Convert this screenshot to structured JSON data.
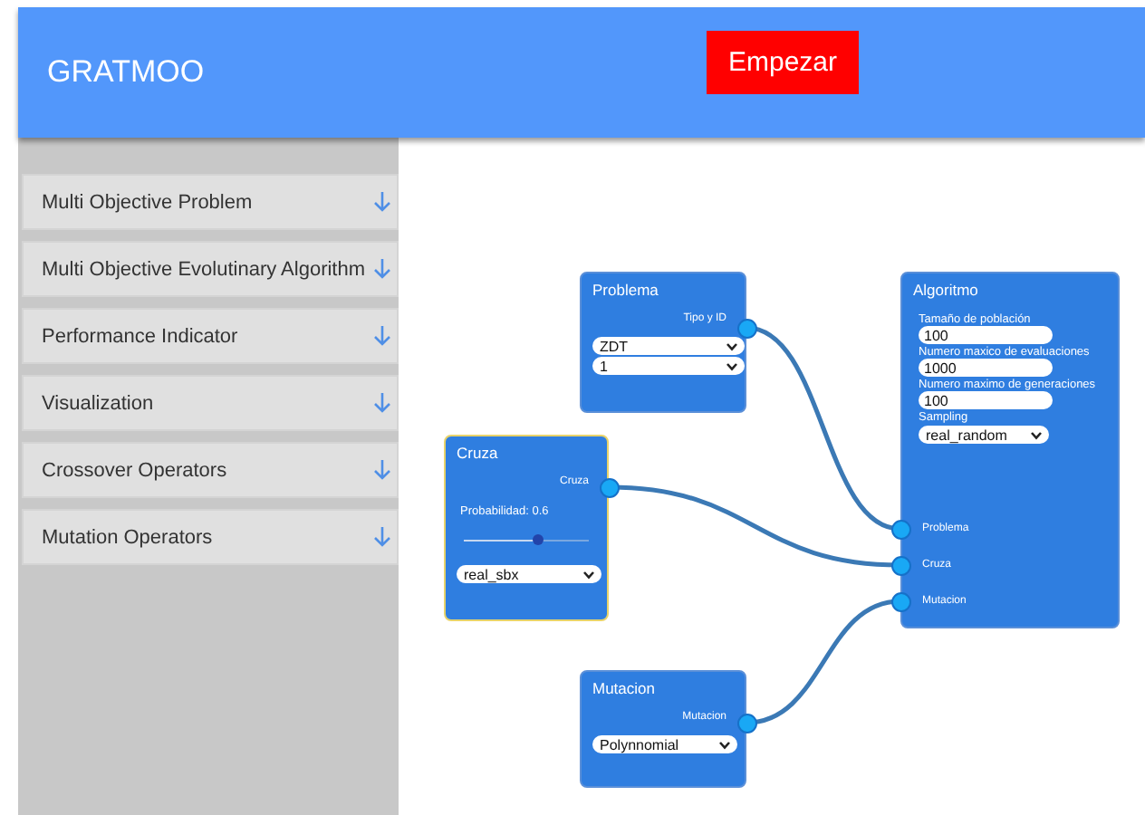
{
  "header": {
    "title": "GRATMOO",
    "start_button": "Empezar"
  },
  "sidebar": {
    "items": [
      {
        "label": "Multi Objective Problem",
        "expanded": false
      },
      {
        "label": "Multi Objective Evolutinary Algorithm",
        "expanded": false
      },
      {
        "label": "Performance Indicator",
        "expanded": false
      },
      {
        "label": "Visualization",
        "expanded": false
      },
      {
        "label": "Crossover Operators",
        "expanded": false
      },
      {
        "label": "Mutation Operators",
        "expanded": false
      }
    ]
  },
  "nodes": [
    {
      "kind": "problem",
      "title": "Problema",
      "selected": false,
      "output": "Tipo y ID",
      "selects": [
        "ZDT",
        "1"
      ]
    },
    {
      "kind": "crossover",
      "title": "Cruza",
      "selected": true,
      "output": "Cruza",
      "probability_label": "Probabilidad: 0.6",
      "level": 0.6,
      "selects": [
        "real_sbx"
      ]
    },
    {
      "kind": "mutation",
      "title": "Mutacion",
      "selected": false,
      "output": "Mutacion",
      "selects": [
        "Polynnomial"
      ]
    },
    {
      "kind": "algorithm",
      "title": "Algoritmo",
      "selected": false,
      "fields": [
        {
          "label": "Tamaño de población",
          "value": "100"
        },
        {
          "label": "Numero maxico de evaluaciones",
          "value": "1000"
        },
        {
          "label": "Numero maximo de generaciones",
          "value": "100"
        }
      ],
      "sampling_label": "Sampling",
      "selects": [
        "real_random"
      ],
      "inputs": [
        "Problema",
        "Cruza",
        "Mutacion"
      ]
    }
  ]
}
